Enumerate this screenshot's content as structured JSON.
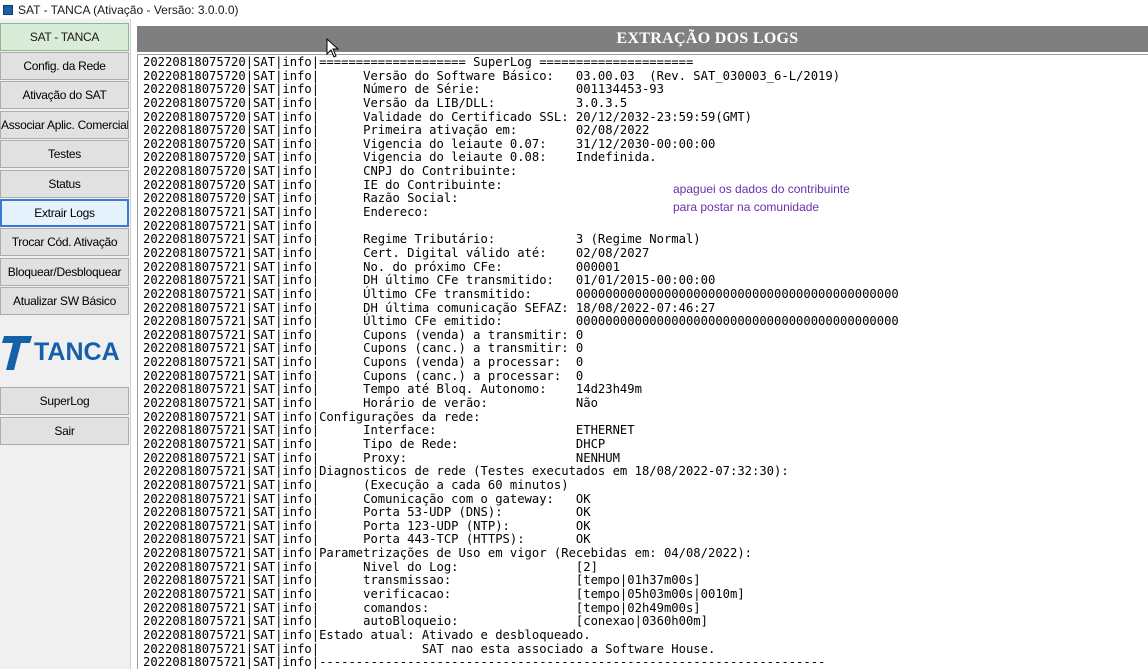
{
  "window": {
    "title": "SAT - TANCA (Ativação - Versão: 3.0.0.0)"
  },
  "sidebar": {
    "header_label": "SAT - TANCA",
    "items": [
      {
        "label": "Config. da Rede"
      },
      {
        "label": "Ativação do SAT"
      },
      {
        "label": "Associar Aplic. Comercial"
      },
      {
        "label": "Testes"
      },
      {
        "label": "Status"
      },
      {
        "label": "Extrair Logs",
        "selected": true
      },
      {
        "label": "Trocar Cód. Ativação"
      },
      {
        "label": "Bloquear/Desbloquear"
      },
      {
        "label": "Atualizar SW Básico"
      }
    ],
    "logo_text": "TANCA",
    "bottom_items": [
      {
        "label": "SuperLog"
      },
      {
        "label": "Sair"
      }
    ]
  },
  "main": {
    "title": "EXTRAÇÃO DOS LOGS",
    "note_line1": "apaguei os dados do contribuinte",
    "note_line2": "para postar na comunidade",
    "log_lines": [
      "20220818075720|SAT|info|==================== SuperLog =====================",
      "20220818075720|SAT|info|      Versão do Software Básico:   03.00.03  (Rev. SAT_030003_6-L/2019)",
      "20220818075720|SAT|info|      Número de Série:             001134453-93",
      "20220818075720|SAT|info|      Versão da LIB/DLL:           3.0.3.5",
      "20220818075720|SAT|info|      Validade do Certificado SSL: 20/12/2032-23:59:59(GMT)",
      "20220818075720|SAT|info|      Primeira ativação em:        02/08/2022",
      "20220818075720|SAT|info|      Vigencia do leiaute 0.07:    31/12/2030-00:00:00",
      "20220818075720|SAT|info|      Vigencia do leiaute 0.08:    Indefinida.",
      "20220818075720|SAT|info|      CNPJ do Contribuinte:",
      "20220818075720|SAT|info|      IE do Contribuinte:",
      "20220818075720|SAT|info|      Razão Social:",
      "20220818075721|SAT|info|      Endereco:",
      "20220818075721|SAT|info|",
      "20220818075721|SAT|info|      Regime Tributário:           3 (Regime Normal)",
      "20220818075721|SAT|info|      Cert. Digital válido até:    02/08/2027",
      "20220818075721|SAT|info|      No. do próximo CFe:          000001",
      "20220818075721|SAT|info|      DH último CFe transmitido:   01/01/2015-00:00:00",
      "20220818075721|SAT|info|      Último CFe transmitido:      00000000000000000000000000000000000000000000",
      "20220818075721|SAT|info|      DH última comunicação SEFAZ: 18/08/2022-07:46:27",
      "20220818075721|SAT|info|      Último CFe emitido:          00000000000000000000000000000000000000000000",
      "20220818075721|SAT|info|      Cupons (venda) a transmitir: 0",
      "20220818075721|SAT|info|      Cupons (canc.) a transmitir: 0",
      "20220818075721|SAT|info|      Cupons (venda) a processar:  0",
      "20220818075721|SAT|info|      Cupons (canc.) a processar:  0",
      "20220818075721|SAT|info|      Tempo até Bloq. Autonomo:    14d23h49m",
      "20220818075721|SAT|info|      Horário de verão:            Não",
      "20220818075721|SAT|info|Configurações da rede:",
      "20220818075721|SAT|info|      Interface:                   ETHERNET",
      "20220818075721|SAT|info|      Tipo de Rede:                DHCP",
      "20220818075721|SAT|info|      Proxy:                       NENHUM",
      "20220818075721|SAT|info|Diagnosticos de rede (Testes executados em 18/08/2022-07:32:30):",
      "20220818075721|SAT|info|      (Execução a cada 60 minutos)",
      "20220818075721|SAT|info|      Comunicação com o gateway:   OK",
      "20220818075721|SAT|info|      Porta 53-UDP (DNS):          OK",
      "20220818075721|SAT|info|      Porta 123-UDP (NTP):         OK",
      "20220818075721|SAT|info|      Porta 443-TCP (HTTPS):       OK",
      "20220818075721|SAT|info|Parametrizações de Uso em vigor (Recebidas em: 04/08/2022):",
      "20220818075721|SAT|info|      Nivel do Log:                [2]",
      "20220818075721|SAT|info|      transmissao:                 [tempo|01h37m00s]",
      "20220818075721|SAT|info|      verificacao:                 [tempo|05h03m00s|0010m]",
      "20220818075721|SAT|info|      comandos:                    [tempo|02h49m00s]",
      "20220818075721|SAT|info|      autoBloqueio:                [conexao|0360h00m]",
      "20220818075721|SAT|info|Estado atual: Ativado e desbloqueado.",
      "20220818075721|SAT|info|              SAT nao esta associado a Software House.",
      "20220818075721|SAT|info|---------------------------------------------------------------------"
    ]
  }
}
